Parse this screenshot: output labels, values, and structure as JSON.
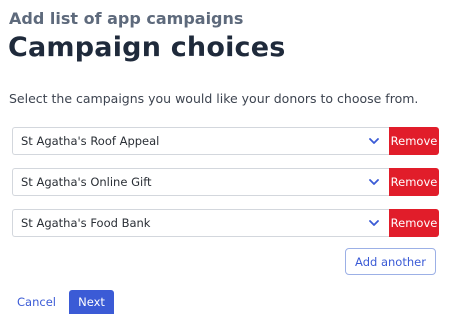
{
  "header": {
    "eyebrow": "Add list of app campaigns",
    "title": "Campaign choices",
    "description": "Select the campaigns you would like your donors to choose from."
  },
  "campaigns": [
    {
      "value": "St Agatha's Roof Appeal",
      "remove_label": "Remove"
    },
    {
      "value": "St Agatha's Online Gift",
      "remove_label": "Remove"
    },
    {
      "value": "St Agatha's Food Bank",
      "remove_label": "Remove"
    }
  ],
  "actions": {
    "add_another_label": "Add another",
    "cancel_label": "Cancel",
    "next_label": "Next"
  },
  "icons": {
    "dropdown": "chevron-down-icon"
  },
  "colors": {
    "remove": "#e11d2a",
    "primary": "#3b5bd6",
    "chevron": "#3b5bd6"
  }
}
